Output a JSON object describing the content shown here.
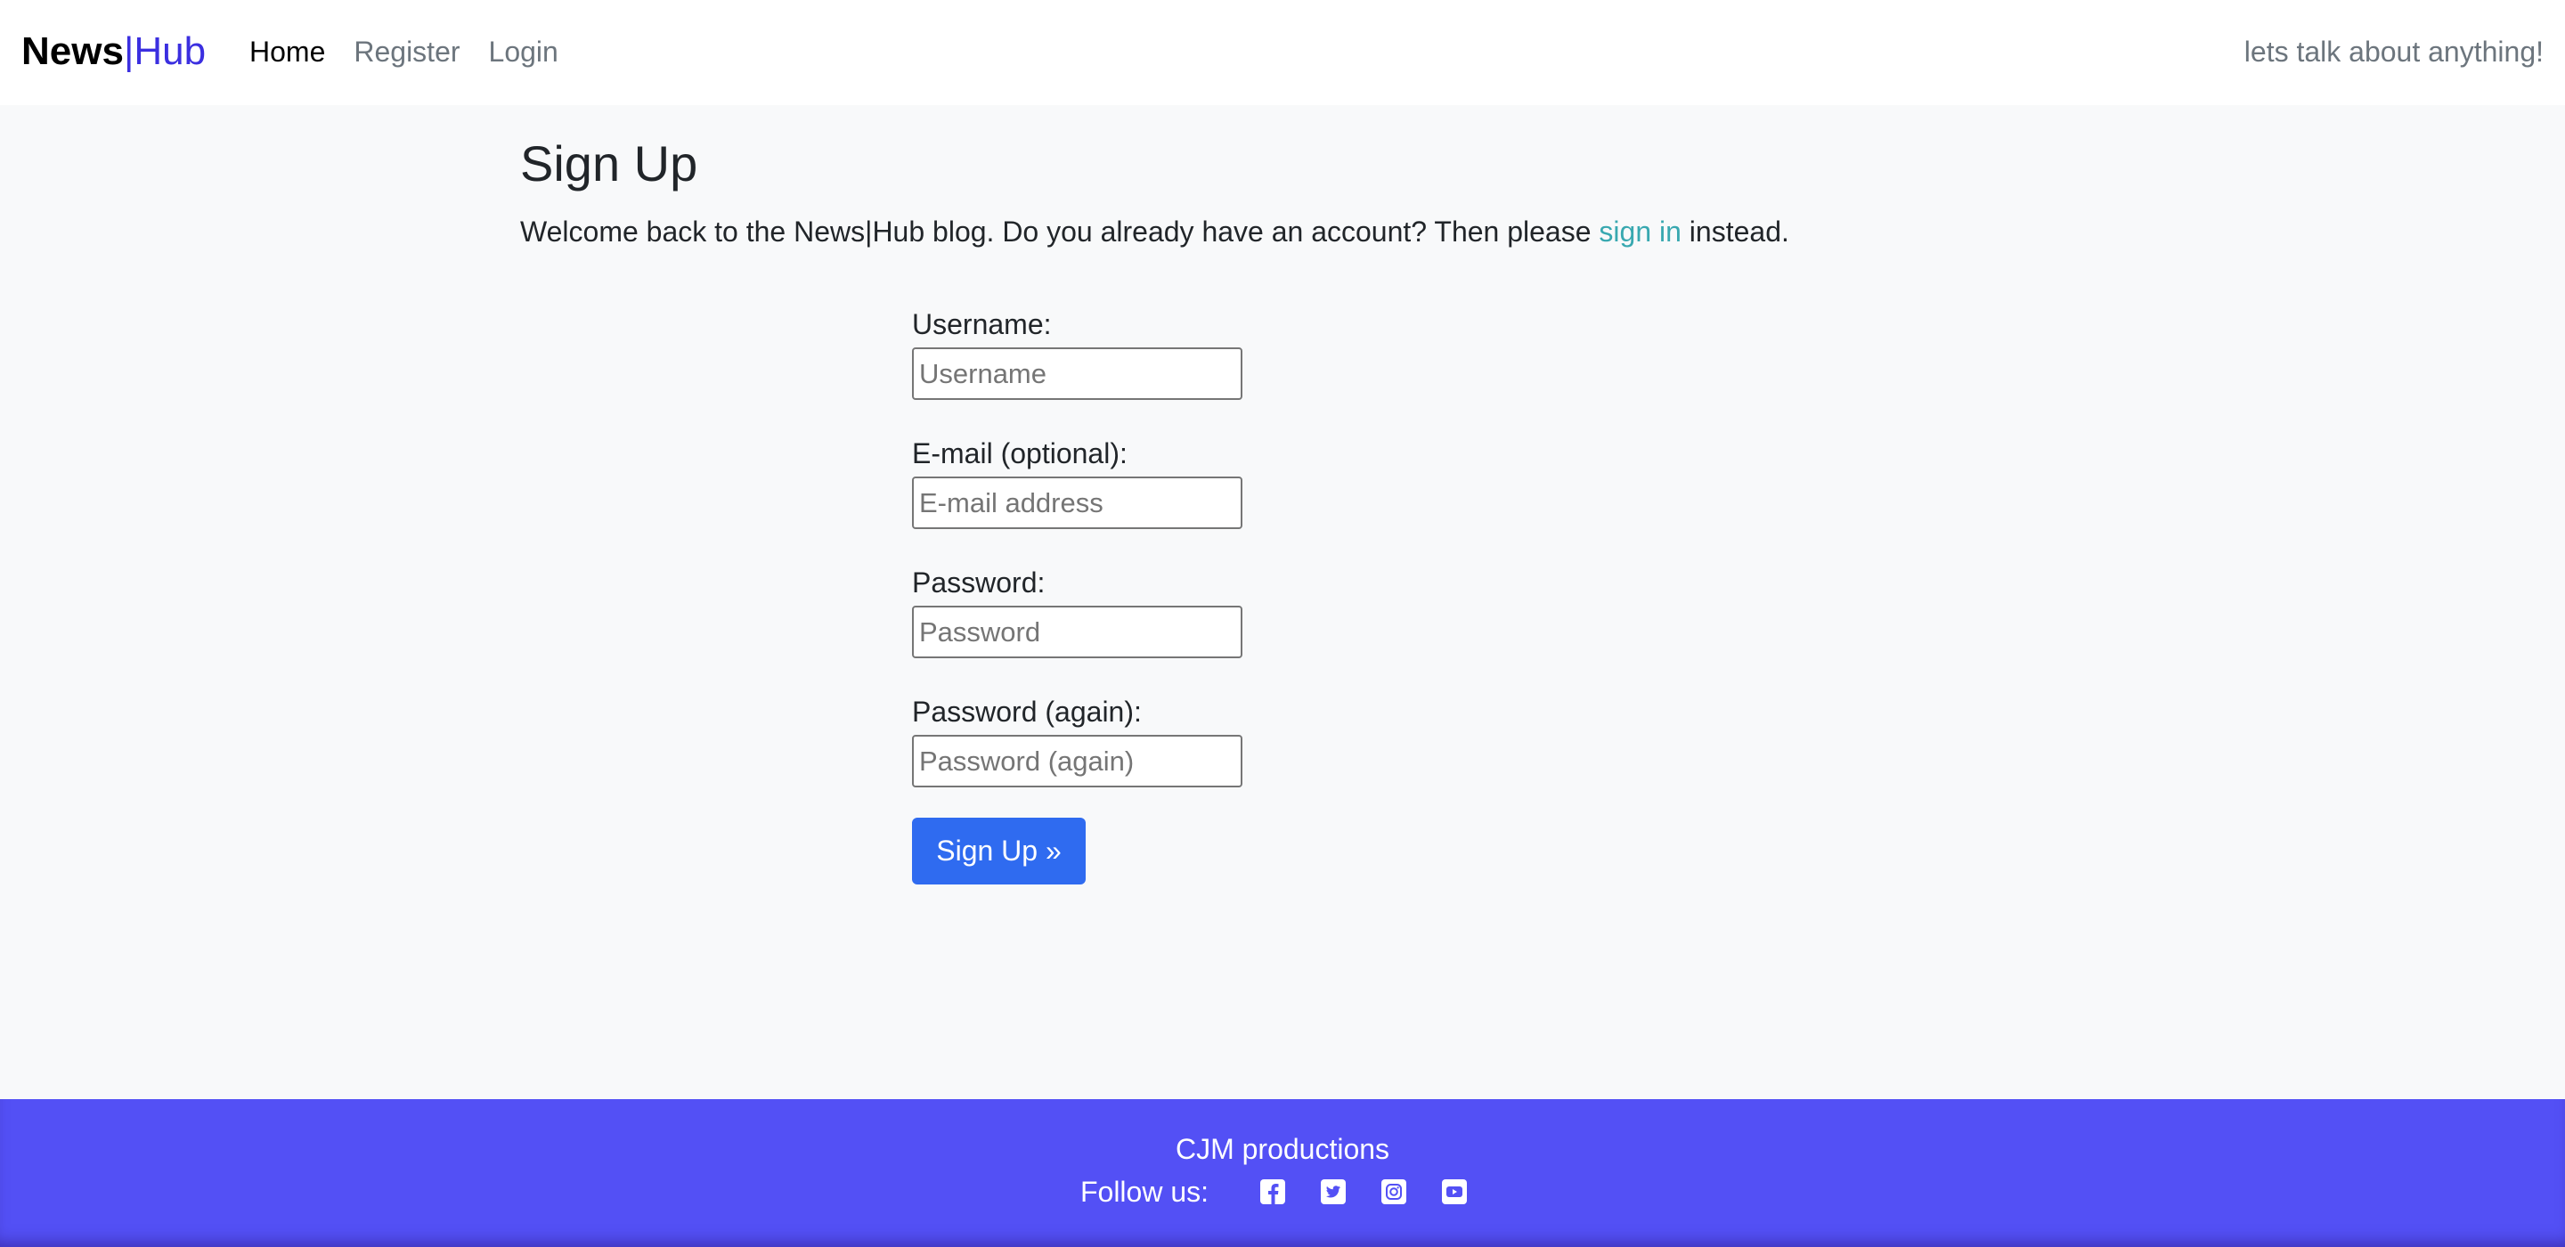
{
  "navbar": {
    "brand": {
      "news": "News",
      "separator": "|",
      "hub": "Hub"
    },
    "links": [
      {
        "label": "Home",
        "active": true
      },
      {
        "label": "Register",
        "active": false
      },
      {
        "label": "Login",
        "active": false
      }
    ],
    "tagline": "lets talk about anything!"
  },
  "main": {
    "title": "Sign Up",
    "intro_before": "Welcome back to the News|Hub blog. Do you already have an account? Then please ",
    "intro_link": "sign in",
    "intro_after": " instead."
  },
  "form": {
    "username": {
      "label": "Username:",
      "placeholder": "Username",
      "value": ""
    },
    "email": {
      "label": "E-mail (optional):",
      "placeholder": "E-mail address",
      "value": ""
    },
    "password": {
      "label": "Password:",
      "placeholder": "Password",
      "value": ""
    },
    "password_again": {
      "label": "Password (again):",
      "placeholder": "Password (again)",
      "value": ""
    },
    "submit_label": "Sign Up »"
  },
  "footer": {
    "title": "CJM productions",
    "follow_label": "Follow us:",
    "social_icons": [
      "facebook-icon",
      "twitter-icon",
      "instagram-icon",
      "youtube-icon"
    ]
  },
  "colors": {
    "brand_accent": "#3b2fe0",
    "link": "#38a8b0",
    "button": "#2f6bf0",
    "footer_bg": "#5350f5",
    "page_bg": "#f8f9fa"
  }
}
